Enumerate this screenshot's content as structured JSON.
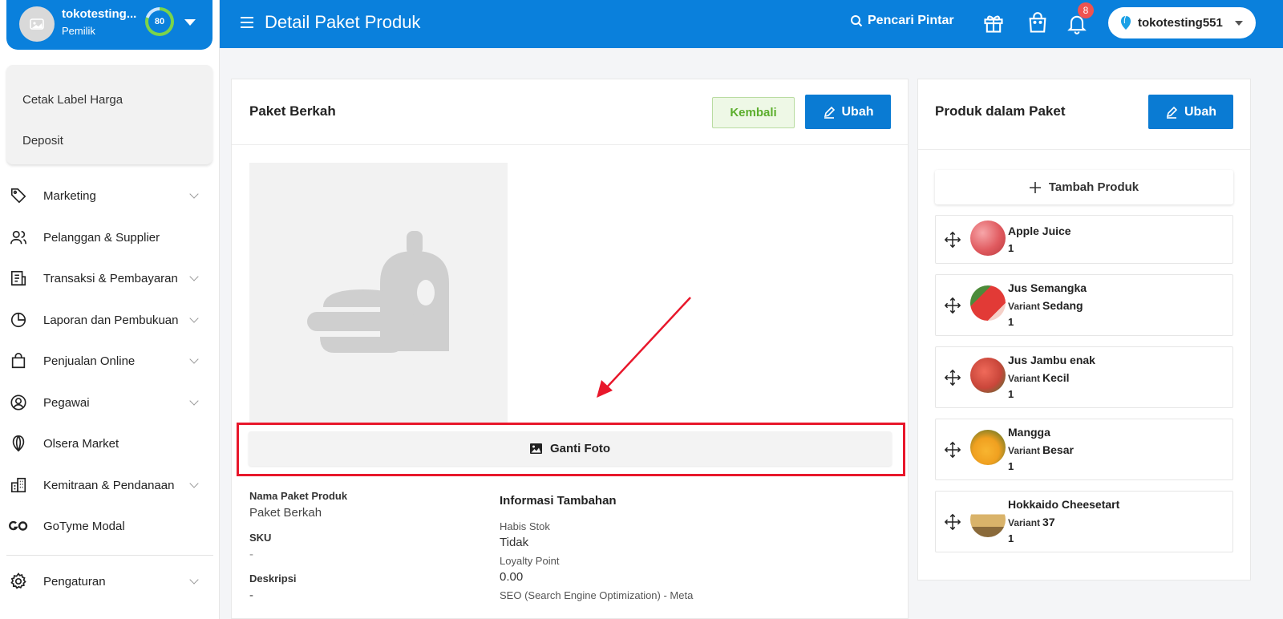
{
  "sidebar": {
    "store_name": "tokotesting...",
    "store_role": "Pemilik",
    "score": "80",
    "submenu": [
      "Cetak Label Harga",
      "Deposit"
    ],
    "items": [
      {
        "label": "Marketing",
        "icon": "tag-icon",
        "chevron": true
      },
      {
        "label": "Pelanggan & Supplier",
        "icon": "users-icon",
        "chevron": false
      },
      {
        "label": "Transaksi & Pembayaran",
        "icon": "receipt-icon",
        "chevron": true
      },
      {
        "label": "Laporan dan Pembukuan",
        "icon": "pie-chart-icon",
        "chevron": true
      },
      {
        "label": "Penjualan Online",
        "icon": "shopping-bag-icon",
        "chevron": true
      },
      {
        "label": "Pegawai",
        "icon": "user-circle-icon",
        "chevron": true
      },
      {
        "label": "Olsera Market",
        "icon": "balloon-icon",
        "chevron": false
      },
      {
        "label": "Kemitraan & Pendanaan",
        "icon": "building-icon",
        "chevron": true
      },
      {
        "label": "GoTyme Modal",
        "icon": "go-icon",
        "chevron": false
      },
      {
        "label": "Pengaturan",
        "icon": "gear-icon",
        "chevron": true
      }
    ]
  },
  "topbar": {
    "title": "Detail Paket Produk",
    "search_label": "Pencari Pintar",
    "notification_count": "8",
    "account_name": "tokotesting551"
  },
  "detail": {
    "title": "Paket Berkah",
    "back_label": "Kembali",
    "edit_label": "Ubah",
    "change_photo_label": "Ganti Foto",
    "fields": {
      "name_label": "Nama Paket Produk",
      "name_value": "Paket Berkah",
      "sku_label": "SKU",
      "sku_value": "-",
      "desc_label": "Deskripsi",
      "desc_value": "-"
    },
    "info": {
      "title": "Informasi Tambahan",
      "out_of_stock_label": "Habis Stok",
      "out_of_stock_value": "Tidak",
      "loyalty_label": "Loyalty Point",
      "loyalty_value": "0.00",
      "seo_label": "SEO (Search Engine Optimization) - Meta"
    }
  },
  "products_panel": {
    "title": "Produk dalam Paket",
    "edit_label": "Ubah",
    "add_label": "Tambah Produk",
    "variant_word": "Variant",
    "items": [
      {
        "name": "Apple Juice",
        "variant": "",
        "qty": "1",
        "color": "#e05a5f"
      },
      {
        "name": "Jus Semangka",
        "variant": "Sedang",
        "qty": "1",
        "color": "#d8322f"
      },
      {
        "name": "Jus Jambu enak",
        "variant": "Kecil",
        "qty": "1",
        "color": "#c9463a"
      },
      {
        "name": "Mangga",
        "variant": "Besar",
        "qty": "1",
        "color": "#f0a020"
      },
      {
        "name": "Hokkaido Cheesetart",
        "variant": "37",
        "qty": "1",
        "color": "#d9b36a"
      }
    ]
  },
  "colors": {
    "primary": "#0a80dc",
    "success": "#5cae2d",
    "highlight": "#e8172b"
  }
}
